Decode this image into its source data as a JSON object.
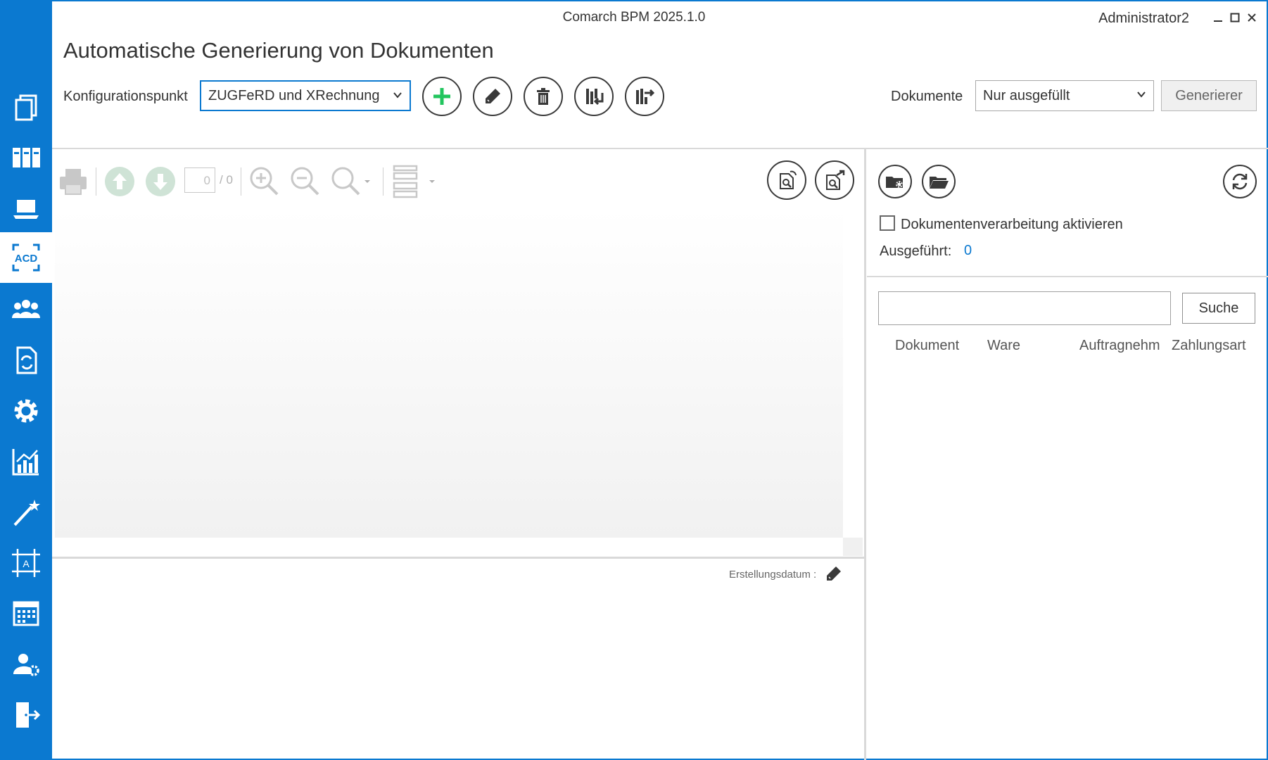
{
  "window": {
    "title": "Comarch BPM 2025.1.0",
    "user": "Administrator2",
    "minimize_icon": "minimize-icon",
    "maximize_icon": "maximize-icon",
    "close_icon": "close-icon"
  },
  "sidebar": {
    "items": [
      {
        "icon": "documents-icon"
      },
      {
        "icon": "binders-icon"
      },
      {
        "icon": "laptop-icon"
      },
      {
        "icon": "acd-icon",
        "text": "ACD",
        "active": true
      },
      {
        "icon": "users-icon"
      },
      {
        "icon": "document-sync-icon"
      },
      {
        "icon": "gear-icon"
      },
      {
        "icon": "chart-icon"
      },
      {
        "icon": "magic-wand-icon"
      },
      {
        "icon": "text-frame-icon",
        "text": "A"
      },
      {
        "icon": "calendar-icon"
      },
      {
        "icon": "user-settings-icon"
      },
      {
        "icon": "exit-icon"
      }
    ]
  },
  "header": {
    "title": "Automatische Generierung von Dokumenten",
    "config_label": "Konfigurationspunkt",
    "config_value": "ZUGFeRD und XRechnung",
    "documents_label": "Dokumente",
    "documents_value": "Nur ausgefüllt",
    "generate_label": "Generierer",
    "colors": {
      "accent": "#0b79d0",
      "add": "#22c55e"
    }
  },
  "viewer": {
    "page_current": "0",
    "page_total": "/ 0"
  },
  "details": {
    "created_label": "Erstellungsdatum :"
  },
  "right_panel": {
    "activate_label": "Dokumentenverarbeitung aktivieren",
    "activate_checked": false,
    "executed_label": "Ausgeführt:",
    "executed_value": "0",
    "search_value": "",
    "search_button": "Suche",
    "columns": [
      "Dokument",
      "Ware",
      "Auftragnehm",
      "Zahlungsart"
    ]
  }
}
